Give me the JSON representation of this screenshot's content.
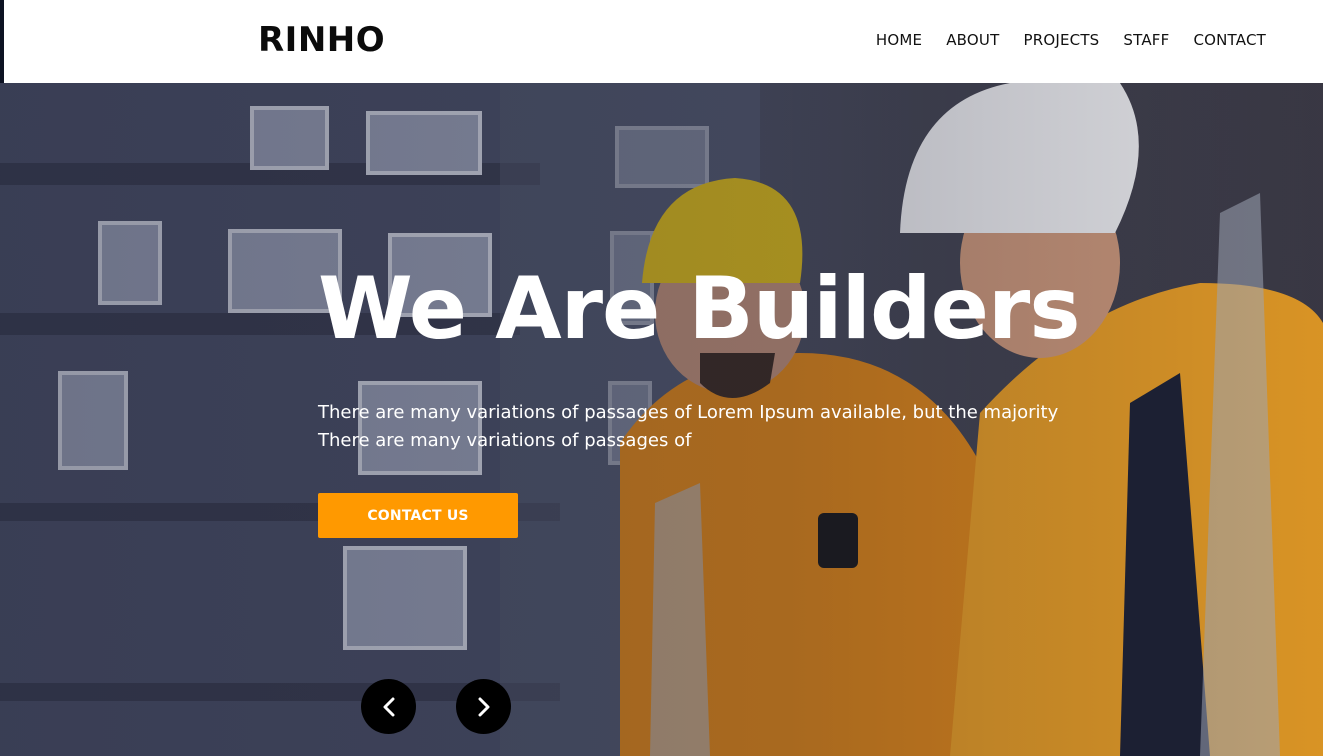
{
  "header": {
    "logo": "RINHO",
    "nav": [
      "HOME",
      "ABOUT",
      "PROJECTS",
      "STAFF",
      "CONTACT"
    ]
  },
  "hero": {
    "title": "We Are Builders",
    "lines": [
      "There are many variations of passages of Lorem Ipsum available, but the majority",
      "There are many variations of passages of"
    ],
    "cta": "CONTACT US"
  },
  "carousel": {
    "prev_icon": "chevron-left-icon",
    "next_icon": "chevron-right-icon"
  },
  "colors": {
    "accent": "#ff9900",
    "header_bg": "#ffffff",
    "arrow_bg": "#000000"
  }
}
